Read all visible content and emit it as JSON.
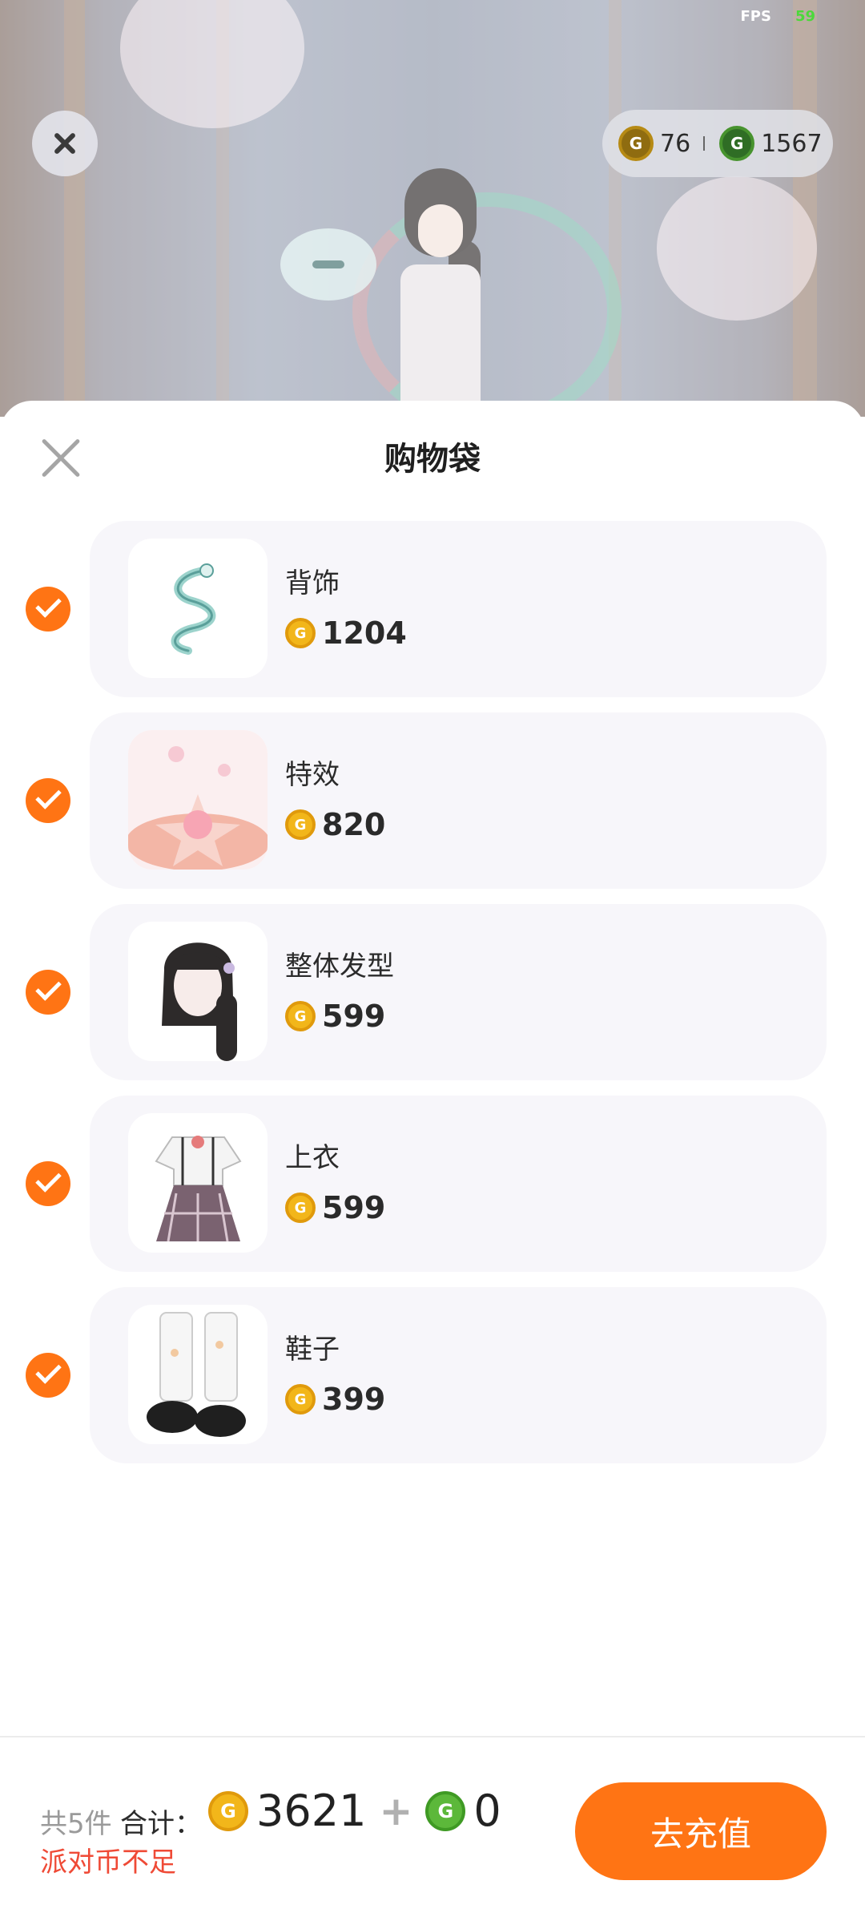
{
  "hud": {
    "fps_label": "FPS",
    "fps_value": "59"
  },
  "currency": {
    "gold_amount": "76",
    "green_amount": "1567",
    "gold_icon": "gold-coin-icon",
    "green_icon": "green-coin-icon"
  },
  "sheet": {
    "title": "购物袋"
  },
  "items": [
    {
      "name": "背饰",
      "price": "1204"
    },
    {
      "name": "特效",
      "price": "820"
    },
    {
      "name": "整体发型",
      "price": "599"
    },
    {
      "name": "上衣",
      "price": "599"
    },
    {
      "name": "鞋子",
      "price": "399"
    }
  ],
  "footer": {
    "count": "共5件",
    "total_label": "合计：",
    "gold_total": "3621",
    "plus": "+",
    "green_total": "0",
    "warning": "派对币不足",
    "button": "去充值"
  },
  "colors": {
    "accent": "#ff7414",
    "warning": "#ef4a36",
    "card": "#f7f6fa"
  }
}
